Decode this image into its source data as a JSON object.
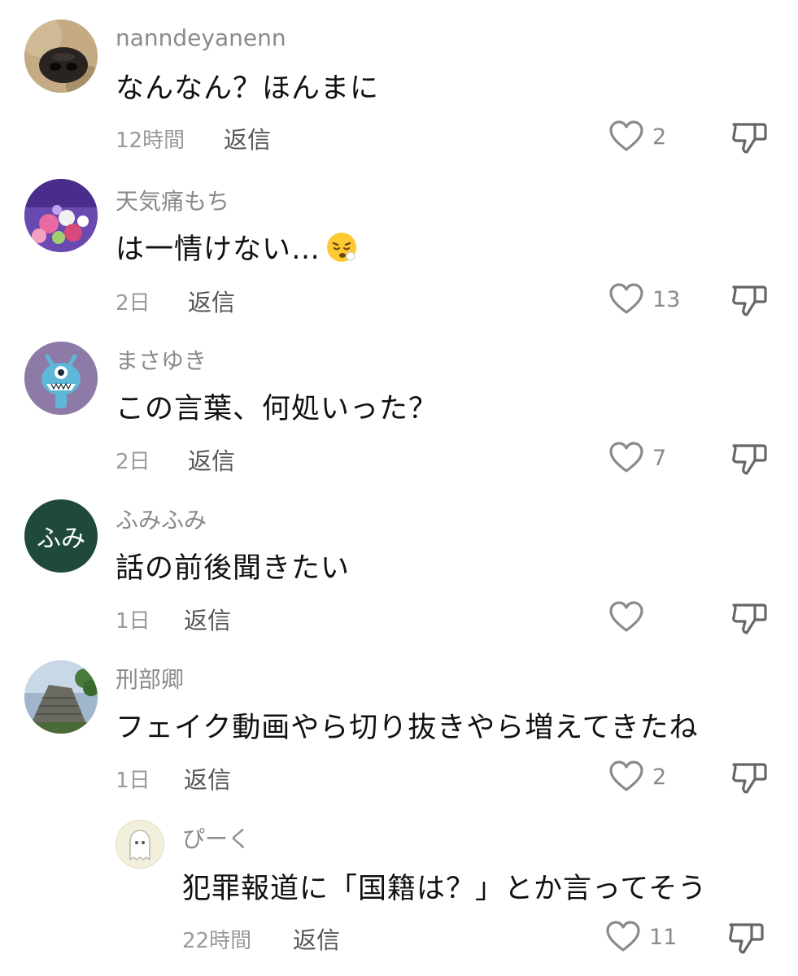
{
  "reply_label": "返信",
  "comments": [
    {
      "name": "nanndeyanenn",
      "text": "なんなん？ほんまに",
      "time": "12時間",
      "likes": "2",
      "avatar": "dog-nose-photo"
    },
    {
      "name": "天気痛もち",
      "text": "は一情けない…",
      "emoji": "tired-face-emoji",
      "time": "2日",
      "likes": "13",
      "avatar": "flower-bouquet-photo"
    },
    {
      "name": "まさゆき",
      "text": "この言葉、何処いった？",
      "time": "2日",
      "likes": "7",
      "avatar": "blue-monster-illustration"
    },
    {
      "name": "ふみふみ",
      "text": "話の前後聞きたい",
      "time": "1日",
      "likes": "",
      "avatar_text": "ふみ"
    },
    {
      "name": "刑部卿",
      "text": "フェイク動画やら切り抜きやら増えてきたね",
      "time": "1日",
      "likes": "2",
      "avatar": "castle-stone-wall-photo"
    }
  ],
  "reply": {
    "name": "ぴーく",
    "text": "犯罪報道に「国籍は？」とか言ってそう",
    "time": "22時間",
    "likes": "11",
    "avatar": "ghost-illustration"
  },
  "colors": {
    "avatar_green": "#1f4a3a",
    "avatar_purple": "#8e7aa6",
    "muted_text": "#8a8a8a"
  }
}
